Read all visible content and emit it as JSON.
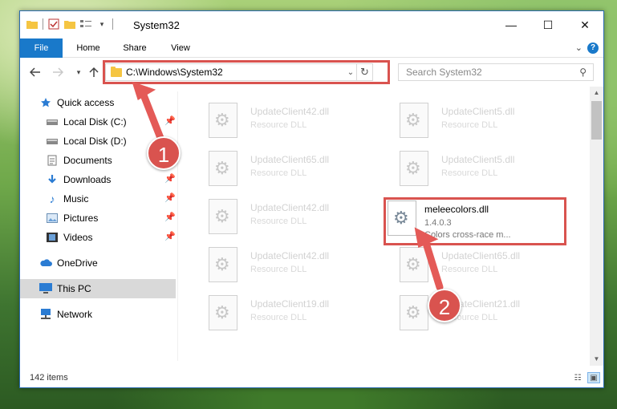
{
  "window": {
    "title": "System32",
    "controls": [
      "—",
      "☐",
      "✕"
    ]
  },
  "ribbon": {
    "tabs": [
      "File",
      "Home",
      "Share",
      "View"
    ],
    "help": "?"
  },
  "navigation": {
    "address": "C:\\Windows\\System32",
    "search_placeholder": "Search System32"
  },
  "sidebar": {
    "items": [
      {
        "label": "Quick access",
        "icon": "star-icon"
      },
      {
        "label": "Local Disk (C:)",
        "icon": "drive-icon"
      },
      {
        "label": "Local Disk (D:)",
        "icon": "drive-icon"
      },
      {
        "label": "Documents",
        "icon": "documents-icon"
      },
      {
        "label": "Downloads",
        "icon": "download-icon"
      },
      {
        "label": "Music",
        "icon": "music-icon"
      },
      {
        "label": "Pictures",
        "icon": "pictures-icon"
      },
      {
        "label": "Videos",
        "icon": "videos-icon"
      },
      {
        "label": "OneDrive",
        "icon": "cloud-icon"
      },
      {
        "label": "This PC",
        "icon": "computer-icon"
      },
      {
        "label": "Network",
        "icon": "network-icon"
      }
    ]
  },
  "files": [
    {
      "name": "UpdateClient42.dll",
      "type": "Resource DLL"
    },
    {
      "name": "UpdateClient5.dll",
      "type": "Resource DLL"
    },
    {
      "name": "UpdateClient65.dll",
      "type": "Resource DLL"
    },
    {
      "name": "UpdateClient5.dll",
      "type": "Resource DLL"
    },
    {
      "name": "UpdateClient42.dll",
      "type": "Resource DLL"
    },
    {
      "name": "UpdateClient42.dll",
      "type": "Resource DLL"
    },
    {
      "name": "UpdateClient65.dll",
      "type": "Resource DLL"
    },
    {
      "name": "UpdateClient19.dll",
      "type": "Resource DLL"
    },
    {
      "name": "UpdateClient21.dll",
      "type": "Resource DLL"
    }
  ],
  "target_file": {
    "name": "meleecolors.dll",
    "version": "1.4.0.3",
    "description": "Colors cross-race m..."
  },
  "status": {
    "item_count": "142 items"
  },
  "annotations": {
    "step1": "1",
    "step2": "2"
  },
  "colors": {
    "accent": "#1979ca",
    "highlight": "#d9534f"
  }
}
